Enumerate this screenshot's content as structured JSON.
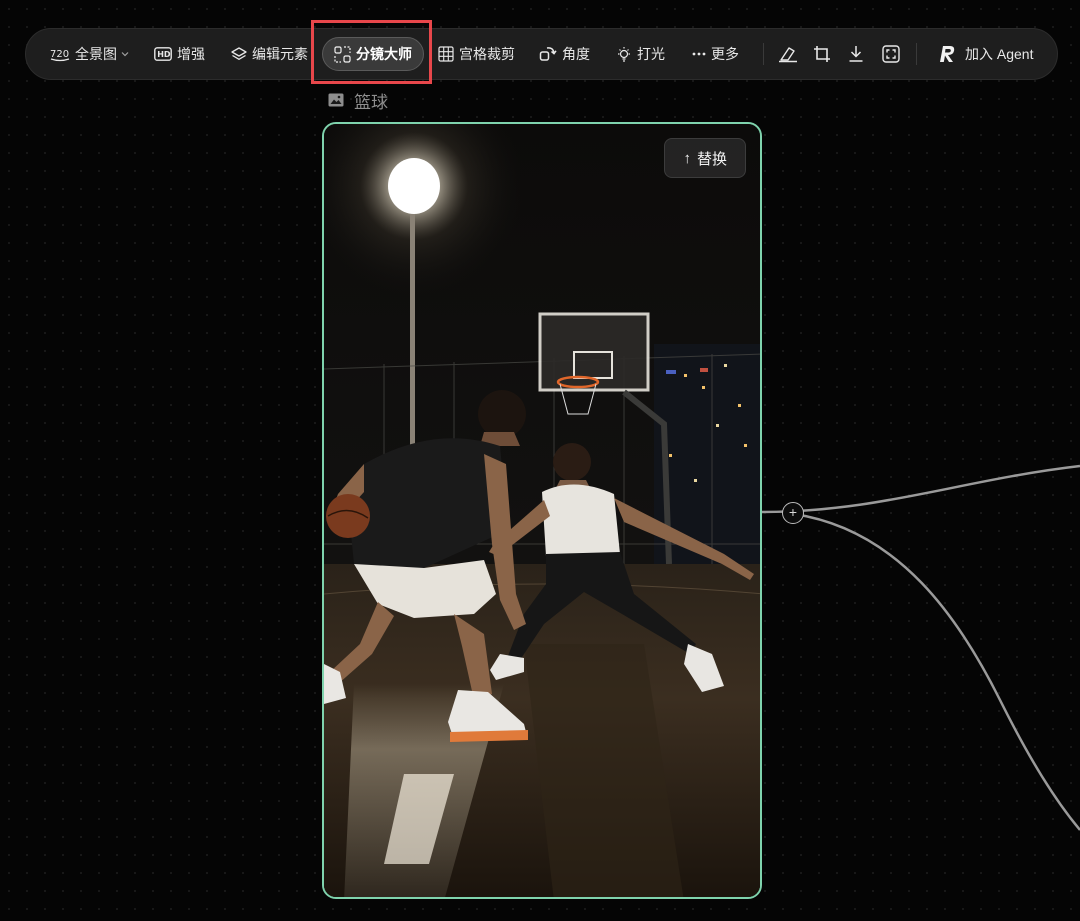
{
  "toolbar": {
    "panorama": {
      "label": "全景图",
      "icon": "panorama-720-icon"
    },
    "enhance": {
      "label": "增强",
      "icon": "hd-icon"
    },
    "edit_elements": {
      "label": "编辑元素",
      "icon": "layers-icon"
    },
    "storyboard": {
      "label": "分镜大师",
      "icon": "storyboard-icon",
      "active": true
    },
    "grid_crop": {
      "label": "宫格裁剪",
      "icon": "grid-icon"
    },
    "angle": {
      "label": "角度",
      "icon": "rotate-icon"
    },
    "lighting": {
      "label": "打光",
      "icon": "bulb-icon"
    },
    "more": {
      "label": "更多",
      "icon": "more-dots-icon"
    },
    "add_agent": {
      "label": "加入 Agent",
      "icon": "agent-logo-icon"
    },
    "icon_tools": [
      "eraser-icon",
      "crop-icon",
      "download-icon",
      "fullscreen-icon"
    ]
  },
  "node": {
    "title": "篮球",
    "title_icon": "image-icon",
    "replace_label": "替换",
    "port_icon": "plus-icon"
  },
  "colors": {
    "canvas_bg": "#050505",
    "toolbar_bg": "#1e1e1e",
    "card_border": "#7fd3ad",
    "highlight": "#e8474b"
  }
}
